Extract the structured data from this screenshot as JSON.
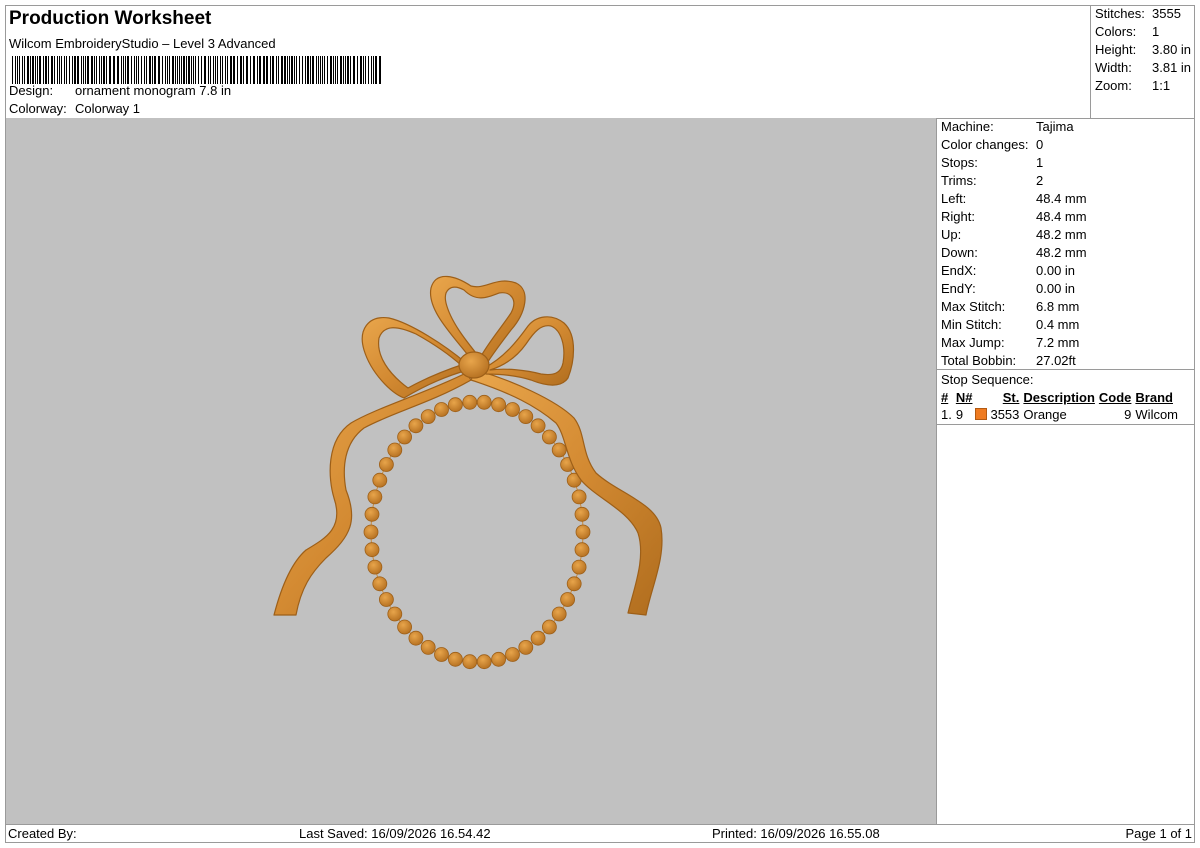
{
  "header": {
    "title": "Production Worksheet",
    "subtitle": "Wilcom EmbroideryStudio – Level 3 Advanced",
    "design_label": "Design:",
    "design_value": "ornament monogram 7.8 in",
    "colorway_label": "Colorway:",
    "colorway_value": "Colorway 1"
  },
  "summary": [
    {
      "label": "Stitches:",
      "value": "3555"
    },
    {
      "label": "Colors:",
      "value": "1"
    },
    {
      "label": "Height:",
      "value": "3.80 in"
    },
    {
      "label": "Width:",
      "value": "3.81 in"
    },
    {
      "label": "Zoom:",
      "value": "1:1"
    }
  ],
  "machine_info": [
    {
      "label": "Machine:",
      "value": "Tajima"
    },
    {
      "label": "Color changes:",
      "value": "0"
    },
    {
      "label": "Stops:",
      "value": "1"
    },
    {
      "label": "Trims:",
      "value": "2"
    },
    {
      "label": "Left:",
      "value": "48.4 mm"
    },
    {
      "label": "Right:",
      "value": "48.4 mm"
    },
    {
      "label": "Up:",
      "value": "48.2 mm"
    },
    {
      "label": "Down:",
      "value": "48.2 mm"
    },
    {
      "label": "EndX:",
      "value": "0.00 in"
    },
    {
      "label": "EndY:",
      "value": "0.00 in"
    },
    {
      "label": "Max Stitch:",
      "value": "6.8 mm"
    },
    {
      "label": "Min Stitch:",
      "value": "0.4 mm"
    },
    {
      "label": "Max Jump:",
      "value": "7.2 mm"
    },
    {
      "label": "Total Bobbin:",
      "value": "27.02ft"
    }
  ],
  "stop_sequence": {
    "title": "Stop Sequence:",
    "headers": {
      "num": "#",
      "needle": "N#",
      "st": "St.",
      "description": "Description",
      "code": "Code",
      "brand": "Brand"
    },
    "rows": [
      {
        "num": "1.",
        "needle": "9",
        "color": "#ef7b21",
        "st": "3553",
        "description": "Orange",
        "code": "9",
        "brand": "Wilcom"
      }
    ]
  },
  "footer": {
    "created_by": "Created By:",
    "last_saved": "Last Saved: 16/09/2026 16.54.42",
    "printed": "Printed: 16/09/2026 16.55.08",
    "page": "Page 1 of 1"
  },
  "colors": {
    "canvas_bg": "#c1c1c1",
    "thread": "#d9943c",
    "thread_dark": "#a8651c",
    "swatch": "#ef7b21"
  }
}
